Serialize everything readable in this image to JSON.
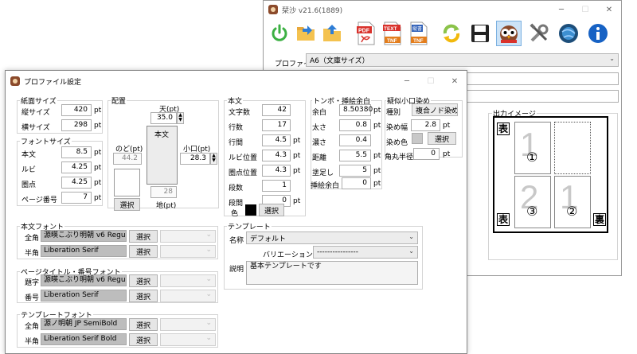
{
  "main_window": {
    "title": "栞沙 v21.6(1889)",
    "toolbar_icons": [
      "power-icon",
      "open-folder-icon",
      "save-folder-icon",
      "pdf-icon",
      "text-tnf-icon",
      "vertical-tnf-icon",
      "refresh-icon",
      "floppy-save-icon",
      "profile-owl-icon",
      "tools-icon",
      "globe-update-icon",
      "info-icon"
    ],
    "toolbar_labels": {
      "pdf": "PDF",
      "text": "TEXT",
      "tnf": "TNF",
      "vert": "縦書",
      "tnf2": "TNF"
    },
    "profile_label": "プロファイル",
    "profile_value": "A6（文庫サイズ）",
    "output_image": {
      "label": "出力イメージ",
      "marks": [
        "裏",
        "表",
        "表",
        "裏"
      ],
      "circled": [
        "①",
        "③",
        "②"
      ],
      "big_digits": [
        "1",
        "2",
        "1"
      ]
    }
  },
  "dialog": {
    "title": "プロファイル設定",
    "paper_size": {
      "label": "紙面サイズ",
      "rows": [
        {
          "label": "縦サイズ",
          "value": "420",
          "unit": "pt"
        },
        {
          "label": "横サイズ",
          "value": "298",
          "unit": "pt"
        }
      ]
    },
    "font_size": {
      "label": "フォントサイズ",
      "rows": [
        {
          "label": "本文",
          "value": "8.5",
          "unit": "pt"
        },
        {
          "label": "ルビ",
          "value": "4.25",
          "unit": "pt"
        },
        {
          "label": "圏点",
          "value": "4.25",
          "unit": "pt"
        },
        {
          "label": "ページ番号",
          "value": "7",
          "unit": "pt"
        }
      ]
    },
    "layout": {
      "label": "配置",
      "top_label": "天(pt)",
      "top_value": "35.0",
      "body_label": "本文",
      "gutter_label": "のど(pt)",
      "gutter_value": "44.2",
      "edge_label": "小口(pt)",
      "edge_value": "28.3",
      "bottom_value": "28",
      "bottom_label": "地(pt)",
      "select_label": "選択"
    },
    "body_text": {
      "label": "本文",
      "rows": [
        {
          "label": "文字数",
          "value": "42",
          "unit": ""
        },
        {
          "label": "行数",
          "value": "17",
          "unit": ""
        },
        {
          "label": "行間",
          "value": "4.5",
          "unit": "pt"
        },
        {
          "label": "ルビ位置",
          "value": "4.3",
          "unit": "pt"
        },
        {
          "label": "圏点位置",
          "value": "4.3",
          "unit": "pt"
        },
        {
          "label": "段数",
          "value": "1",
          "unit": ""
        },
        {
          "label": "段間",
          "value": "0",
          "unit": "pt"
        }
      ],
      "color_label": "色",
      "color_value": "#000000",
      "select_label": "選択"
    },
    "crop_marks": {
      "label": "トンボ・挿絵余白",
      "rows": [
        {
          "label": "余白",
          "value": "8.50380",
          "unit": "pt"
        },
        {
          "label": "太さ",
          "value": "0.8",
          "unit": "pt"
        },
        {
          "label": "濃さ",
          "value": "0.4",
          "unit": ""
        },
        {
          "label": "距離",
          "value": "5.5",
          "unit": "pt"
        },
        {
          "label": "塗足し",
          "value": "5",
          "unit": "pt"
        },
        {
          "label": "挿絵余白",
          "value": "0",
          "unit": "pt"
        }
      ]
    },
    "fore_edge": {
      "label": "疑似小口染め",
      "type_label": "種別",
      "type_value": "複合ノド染め",
      "width_label": "染め幅",
      "width_value": "2.8",
      "width_unit": "pt",
      "color_label": "染め色",
      "color_value": "#c8c8c8",
      "select_label": "選択",
      "radius_label": "角丸半径",
      "radius_value": "0",
      "radius_unit": "pt"
    },
    "body_font": {
      "label": "本文フォント",
      "rows": [
        {
          "label": "全角",
          "value": "源暎こぶり明朝 v6 Regular",
          "button": "選択"
        },
        {
          "label": "半角",
          "value": "Liberation Serif",
          "button": "選択"
        }
      ]
    },
    "title_font": {
      "label": "ページタイトル・番号フォント",
      "rows": [
        {
          "label": "題字",
          "value": "源暎こぶり明朝 v6 Regular",
          "button": "選択"
        },
        {
          "label": "番号",
          "value": "Liberation Serif",
          "button": "選択"
        }
      ]
    },
    "template_font": {
      "label": "テンプレートフォント",
      "rows": [
        {
          "label": "全角",
          "value": "源ノ明朝 JP SemiBold",
          "button": "選択"
        },
        {
          "label": "半角",
          "value": "Liberation Serif Bold",
          "button": "選択"
        }
      ]
    },
    "template": {
      "label": "テンプレート",
      "name_label": "名称",
      "name_value": "デフォルト",
      "variation_label": "バリエーション",
      "variation_value": "----------------",
      "desc_label": "説明",
      "desc_value": "基本テンプレートです"
    }
  }
}
